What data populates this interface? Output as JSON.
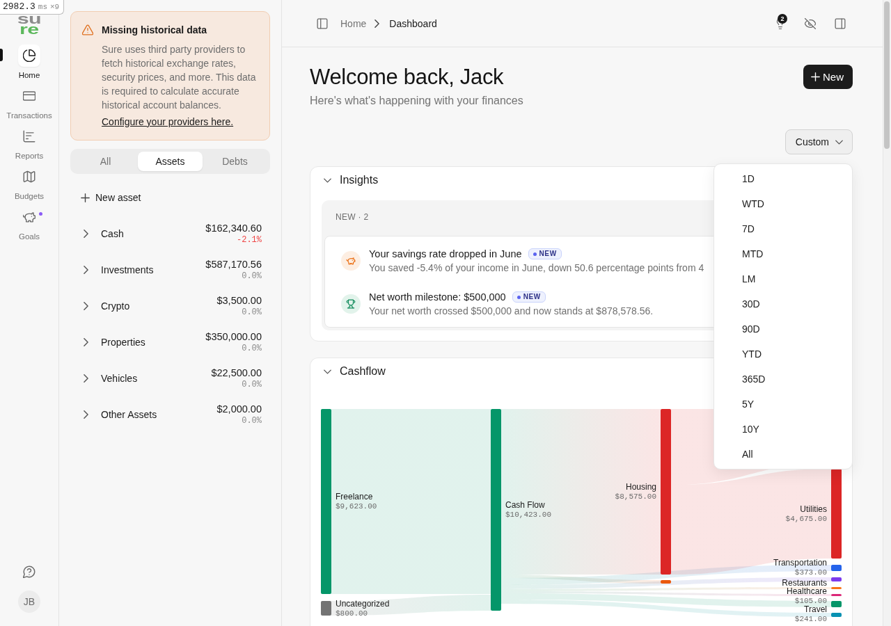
{
  "perf_overlay": {
    "time": "2982.3",
    "unit": "ms",
    "repeat": "×9"
  },
  "logo": {
    "lines": [
      "su",
      "re"
    ]
  },
  "nav": {
    "items": [
      {
        "label": "Home",
        "selected": true,
        "notification": false
      },
      {
        "label": "Transactions",
        "selected": false,
        "notification": false
      },
      {
        "label": "Reports",
        "selected": false,
        "notification": false
      },
      {
        "label": "Budgets",
        "selected": false,
        "notification": false
      },
      {
        "label": "Goals",
        "selected": false,
        "notification": true
      }
    ],
    "avatar_initials": "JB"
  },
  "alert": {
    "title": "Missing historical data",
    "body": "Sure uses third party providers to fetch historical exchange rates, security prices, and more. This data is required to calculate accurate historical account balances.",
    "link": "Configure your providers here."
  },
  "account_tabs": [
    {
      "label": "All",
      "selected": false
    },
    {
      "label": "Assets",
      "selected": true
    },
    {
      "label": "Debts",
      "selected": false
    }
  ],
  "new_asset": "New asset",
  "account_groups": [
    {
      "name": "Cash",
      "balance": "$162,340.60",
      "change": "-2.1%",
      "negative": true,
      "expanded": false
    },
    {
      "name": "Investments",
      "balance": "$587,170.56",
      "change": "0.0%",
      "negative": false,
      "expanded": false
    },
    {
      "name": "Crypto",
      "balance": "$3,500.00",
      "change": "0.0%",
      "negative": false,
      "expanded": false
    },
    {
      "name": "Properties",
      "balance": "$350,000.00",
      "change": "0.0%",
      "negative": false,
      "expanded": false
    },
    {
      "name": "Vehicles",
      "balance": "$22,500.00",
      "change": "0.0%",
      "negative": false,
      "expanded": false
    },
    {
      "name": "Other Assets",
      "balance": "$2,000.00",
      "change": "0.0%",
      "negative": false,
      "expanded": false
    }
  ],
  "breadcrumb": [
    "Home",
    "Dashboard"
  ],
  "header": {
    "insights_count": "2"
  },
  "welcome": {
    "title": "Welcome back, Jack",
    "subtitle": "Here's what's happening with your finances",
    "new_button": "New"
  },
  "period_select": {
    "value": "Custom",
    "expanded": true,
    "options": [
      {
        "label": "1D",
        "selected": false
      },
      {
        "label": "WTD",
        "selected": false
      },
      {
        "label": "7D",
        "selected": false
      },
      {
        "label": "MTD",
        "selected": false
      },
      {
        "label": "LM",
        "selected": false
      },
      {
        "label": "30D",
        "selected": false
      },
      {
        "label": "90D",
        "selected": false
      },
      {
        "label": "YTD",
        "selected": false
      },
      {
        "label": "365D",
        "selected": false
      },
      {
        "label": "5Y",
        "selected": false
      },
      {
        "label": "10Y",
        "selected": false
      },
      {
        "label": "All",
        "selected": false
      }
    ]
  },
  "insights": {
    "title": "Insights",
    "expanded": true,
    "group_label": "NEW · 2",
    "items": [
      {
        "kind": "savings",
        "title": "Your savings rate dropped in June",
        "badge": "NEW",
        "description": "You saved -5.4% of your income in June, down 50.6 percentage points from 4"
      },
      {
        "kind": "milestone",
        "title": "Net worth milestone: $500,000",
        "badge": "NEW",
        "description": "Your net worth crossed $500,000 and now stands at $878,578.56."
      }
    ]
  },
  "cashflow": {
    "title": "Cashflow",
    "expanded": true,
    "columns": [
      [
        {
          "label": "Freelance",
          "amount": "$9,623.00",
          "color": "#059669"
        },
        {
          "label": "Uncategorized",
          "amount": "$800.00",
          "color": "#737373"
        }
      ],
      [
        {
          "label": "Cash Flow",
          "amount": "$10,423.00",
          "color": "#059669"
        }
      ],
      [
        {
          "label": "Housing",
          "amount": "$8,575.00",
          "color": "#dc2626"
        },
        {
          "color": "#ea580c"
        }
      ],
      [
        {
          "label": "Utilities",
          "amount": "$4,675.00",
          "color": "#dc2626"
        },
        {
          "label": "Transportation",
          "amount": "$373.00",
          "color": "#2563eb"
        },
        {
          "label": "Restaurants",
          "color": "#7c3aed"
        },
        {
          "color": "#f97316"
        },
        {
          "label": "Healthcare",
          "amount": "$105.00",
          "color": "#db2777"
        },
        {
          "color": "#059669"
        },
        {
          "label": "Travel",
          "amount": "$241.00",
          "color": "#0891b2"
        }
      ]
    ]
  }
}
